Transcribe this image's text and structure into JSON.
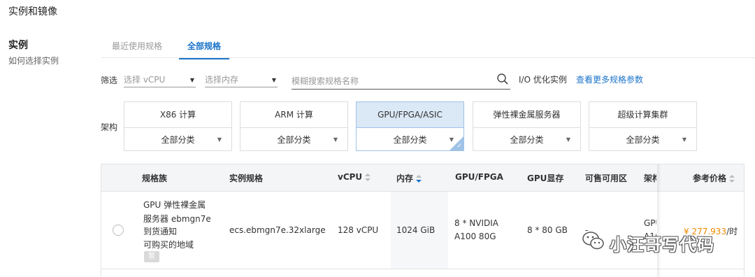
{
  "section_title": "实例和镜像",
  "left": {
    "title": "实例",
    "help_link": "如何选择实例"
  },
  "tabs": [
    {
      "label": "最近使用规格"
    },
    {
      "label": "全部规格"
    }
  ],
  "filter": {
    "label": "筛选",
    "vcpu_placeholder": "选择 vCPU",
    "memory_placeholder": "选择内存",
    "search_placeholder": "模糊搜索规格名称",
    "io_label": "I/O 优化实例",
    "more_params_link": "查看更多规格参数"
  },
  "arch": {
    "label": "架构",
    "cards": [
      {
        "name": "X86 计算",
        "sub": "全部分类"
      },
      {
        "name": "ARM 计算",
        "sub": "全部分类"
      },
      {
        "name": "GPU/FPGA/ASIC",
        "sub": "全部分类"
      },
      {
        "name": "弹性裸金属服务器",
        "sub": "全部分类"
      },
      {
        "name": "超级计算集群",
        "sub": "全部分类"
      }
    ]
  },
  "table": {
    "headers": {
      "family": "规格族",
      "spec": "实例规格",
      "vcpu": "vCPU",
      "memory": "内存",
      "gpu_fpga": "GPU/FPGA",
      "gpu_mem": "GPU显存",
      "zones": "可售可用区",
      "arch": "架构",
      "price": "参考价格"
    },
    "row": {
      "family_line1": "GPU 弹性裸金属",
      "family_line2": "服务器 ebmgn7e",
      "notify_link": "到货通知",
      "regions_link": "可购买的地域",
      "badge": "暂",
      "spec": "ecs.ebmgn7e.32xlarge",
      "vcpu": "128 vCPU",
      "memory": "1024 GiB",
      "gpu_line1": "8 * NVIDIA",
      "gpu_line2": "A100 80G",
      "gpu_mem": "8 * 80 GB",
      "zones": "-",
      "arch_line1": "GPU",
      "arch_line2": "A1(",
      "price_value": "¥ 277.933",
      "price_unit": "/时"
    }
  },
  "watermark": "小汪哥写代码",
  "colors": {
    "accent": "#1a73c8",
    "price": "#f08a00",
    "selected_bg": "#dbe8f5"
  }
}
